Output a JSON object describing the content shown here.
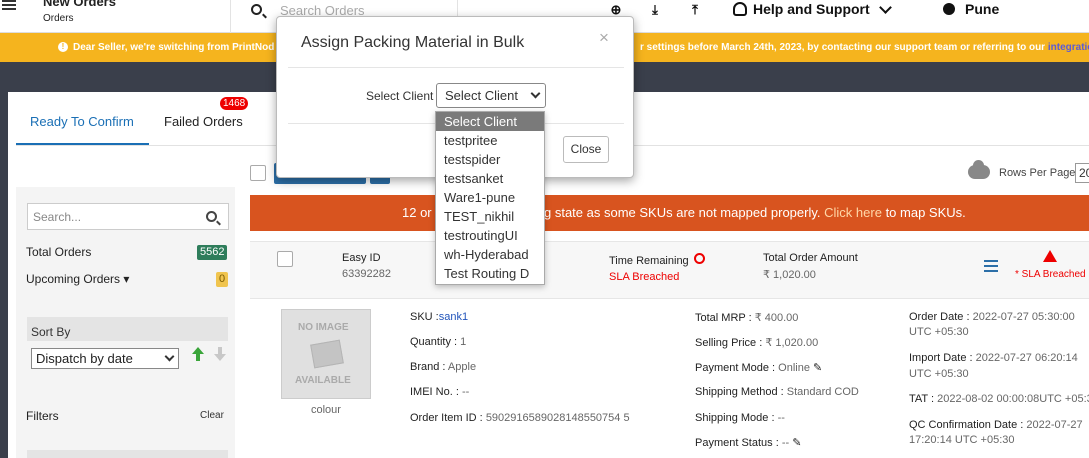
{
  "header": {
    "title": "New Orders",
    "subtitle": "Orders",
    "search_placeholder": "Search Orders",
    "help_label": "Help and Support",
    "user_name": "Pune",
    "icons": [
      "hamburger-icon",
      "search-icon",
      "plus-circle-icon",
      "download-icon",
      "upload-icon",
      "headset-icon",
      "chevron-down-icon",
      "user-icon"
    ]
  },
  "notice": {
    "text_left": "Dear Seller, we're switching from PrintNod",
    "text_right": "r settings before March 24th, 2023, by contacting our support team or referring to our",
    "link": "integration"
  },
  "tabs": [
    {
      "label": "Ready To Confirm",
      "active": true
    },
    {
      "label": "Failed Orders",
      "badge": "1468"
    }
  ],
  "sidebar": {
    "search_placeholder": "Search...",
    "total_orders_label": "Total Orders",
    "total_orders_count": "5562",
    "upcoming_orders_label": "Upcoming Orders ▾",
    "upcoming_orders_count": "0",
    "sort_by_label": "Sort By",
    "sort_value": "Dispatch by date",
    "filters_label": "Filters",
    "clear_label": "Clear"
  },
  "toolbar": {
    "rows_per_page_label": "Rows Per Page",
    "rows_per_page_value": "20"
  },
  "warning": {
    "text_left": "12 or",
    "text_right": "g state as some SKUs are not mapped properly.",
    "link": "Click here",
    "suffix": "to map SKUs."
  },
  "order": {
    "easy_id_label": "Easy ID",
    "easy_id_value": "63392282",
    "time_remaining_label": "Time Remaining",
    "sla_status": "SLA Breached",
    "total_amount_label": "Total Order Amount",
    "total_amount_value": "₹ 1,020.00",
    "sla_flag": "* SLA Breached",
    "image_text_top": "NO IMAGE",
    "image_text_bottom": "AVAILABLE",
    "image_caption": "colour",
    "sku_label": "SKU :",
    "sku_value": "sank1",
    "quantity_label": "Quantity :",
    "quantity_value": "1",
    "brand_label": "Brand :",
    "brand_value": "Apple",
    "imei_label": "IMEI No. :",
    "imei_value": "--",
    "order_item_label": "Order Item ID :",
    "order_item_value": "5902916589028148550754 5",
    "mrp_label": "Total MRP :",
    "mrp_value": "₹ 400.00",
    "selling_label": "Selling Price :",
    "selling_value": "₹ 1,020.00",
    "payment_mode_label": "Payment Mode :",
    "payment_mode_value": "Online",
    "shipping_method_label": "Shipping Method :",
    "shipping_method_value": "Standard COD",
    "shipping_mode_label": "Shipping Mode :",
    "shipping_mode_value": "--",
    "payment_status_label": "Payment Status :",
    "payment_status_value": "--",
    "order_date_label": "Order Date :",
    "order_date_value": "2022-07-27 05:30:00",
    "order_date_tz": "UTC +05:30",
    "import_date_label": "Import Date :",
    "import_date_value": "2022-07-27 06:20:14",
    "import_date_tz": "UTC +05:30",
    "tat_label": "TAT :",
    "tat_value": "2022-08-02 00:00:08UTC +05:3",
    "qc_label": "QC Confirmation Date :",
    "qc_value": "2022-07-27",
    "qc_value2": "17:20:14 UTC +05:30"
  },
  "modal": {
    "title": "Assign Packing Material in Bulk",
    "close_x": "×",
    "select_label": "Select Client",
    "select_value": "Select Client",
    "close_button": "Close",
    "options": [
      "Select Client",
      "testpritee",
      "testspider",
      "testsanket",
      "Ware1-pune",
      "TEST_nikhil",
      "testroutingUI",
      "wh-Hyderabad",
      "Test Routing D"
    ]
  }
}
